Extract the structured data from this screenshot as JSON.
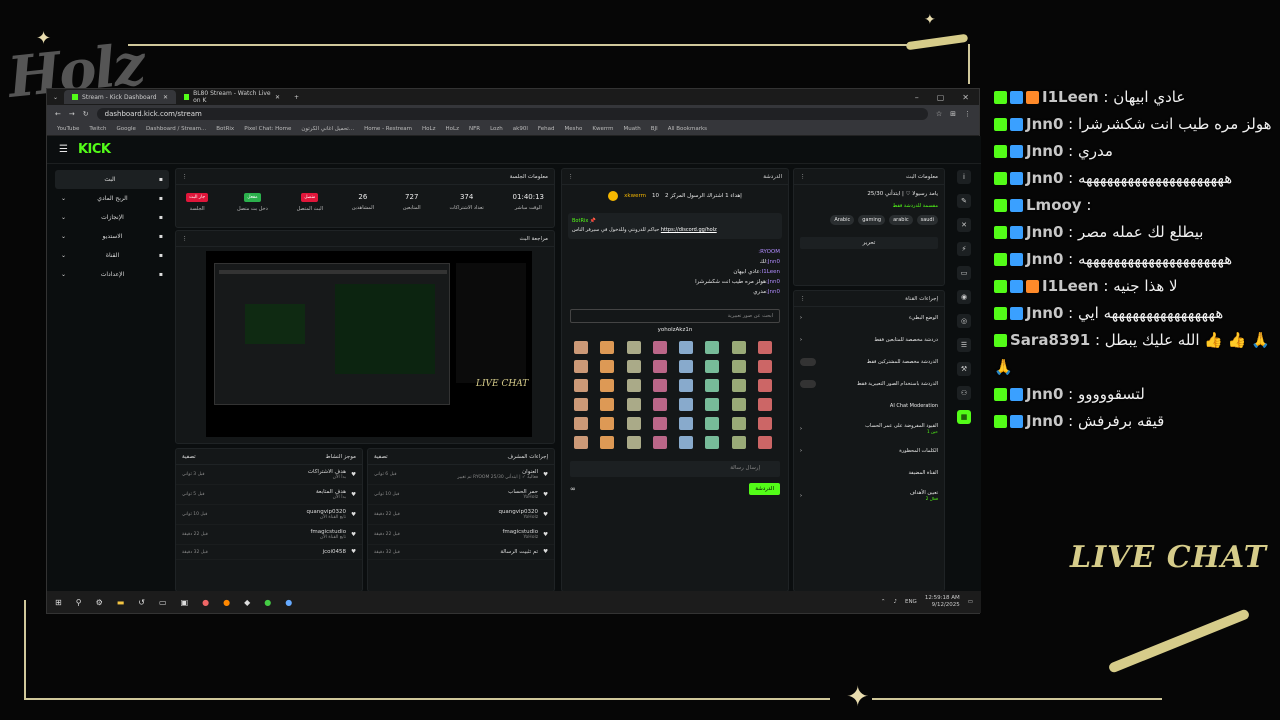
{
  "overlay": {
    "logo_text": "Holz",
    "live_chat_label": "LIVE CHAT"
  },
  "browser": {
    "tabs": [
      {
        "label": "Stream - Kick Dashboard",
        "active": true
      },
      {
        "label": "BL80 Stream - Watch Live on K",
        "active": false
      }
    ],
    "url": "dashboard.kick.com/stream",
    "bookmarks": [
      "YouTube",
      "Twitch",
      "Google",
      "Dashboard / Stream...",
      "BotRix",
      "Pixel Chat: Home",
      "تحميل اغاني الكرتون...",
      "Home - Restream",
      "HoLz",
      "HoLz",
      "NFR",
      "Lozh",
      "ak90l",
      "Fehad",
      "Mesho",
      "Kwerrm",
      "Muath",
      "BJl",
      "All Bookmarks"
    ]
  },
  "kick": {
    "logo": "KICK",
    "nav": [
      {
        "label": "البث",
        "icon": "live-icon"
      },
      {
        "label": "الربح المادي",
        "icon": "money-icon"
      },
      {
        "label": "الإنجازات",
        "icon": "trophy-icon"
      },
      {
        "label": "الاستديو",
        "icon": "studio-icon"
      },
      {
        "label": "القناة",
        "icon": "channel-icon"
      },
      {
        "label": "الإعدادات",
        "icon": "settings-icon"
      }
    ],
    "session": {
      "title": "معلومات الجلسة",
      "stats": [
        {
          "value": "01:40:13",
          "label": "الوقت مباشر"
        },
        {
          "value": "374",
          "label": "تعداد الاشتراكات"
        },
        {
          "value": "727",
          "label": "المتابعين"
        },
        {
          "value": "26",
          "label": "المشاهدين"
        }
      ],
      "badges": [
        {
          "text": "متصل",
          "label": "البث المتصل",
          "color": "#e0163a"
        },
        {
          "text": "مفعل",
          "label": "دخل بث متصل",
          "color": "#2bb14c"
        },
        {
          "text": "جار البث",
          "label": "الجلسة",
          "color": "#e0163a"
        }
      ]
    },
    "preview_title": "مراجعة البث",
    "preview_overlay": "LIVE CHAT",
    "activity": {
      "title": "موجز النشاط",
      "filter": "تصفية",
      "rows": [
        {
          "text": "هدف الاشتراكات",
          "sub": "بدأ الآن",
          "time": "قبل 3 ثواني"
        },
        {
          "text": "هدف المتابعة",
          "sub": "بدأ الآن",
          "time": "قبل 5 ثواني"
        },
        {
          "text": "quangvip0320",
          "sub": "تابع القناة الآن",
          "time": "قبل 10 ثواني"
        },
        {
          "text": "fmagicstudio",
          "sub": "تابع القناة الآن",
          "time": "قبل 22 دقيقة"
        },
        {
          "text": "jcoi0458",
          "sub": "",
          "time": "قبل 32 دقيقة"
        }
      ]
    },
    "mod": {
      "title": "إجراءات المشرف",
      "filter": "تصفية",
      "header_note": "حاليا، شاهد",
      "rows": [
        {
          "text": "العنوان",
          "sub": "تم تغيير RYOOM فعالية ✓ | ابتدأني 25/30",
          "time": "قبل 6 ثواني"
        },
        {
          "text": "حمر الحساب",
          "sub": "YoHolz",
          "time": "قبل 10 ثواني"
        },
        {
          "text": "quangvip0320",
          "sub": "YoHolz",
          "time": "قبل 22 دقيقة"
        },
        {
          "text": "fmagicstudio",
          "sub": "YoHolz",
          "time": "قبل 22 دقيقة"
        },
        {
          "text": "تم تثبيت الرسالة",
          "sub": "",
          "time": "قبل 32 دقيقة"
        }
      ]
    },
    "chat": {
      "title": "الدردشة",
      "top_user": "xkwerm",
      "top_count": "10",
      "top_text": "إهداء 1 اشتراك الرسول المركز 2",
      "pinned_by": "BotRix",
      "pinned_link": "https://discord.gg/holz",
      "pinned_text": "حياكم للدرونتي وللدخول في سيرفر الناس",
      "messages": [
        {
          "user": "RYOOM:",
          "text": ""
        },
        {
          "user": "Jnn0:",
          "text": "لك"
        },
        {
          "user": "I1Leen:",
          "text": "عادي ابيهان"
        },
        {
          "user": "Jnn0:",
          "text": "هولز مره طيب انت شكشرشرا"
        },
        {
          "user": "Jnn0:",
          "text": "مدري"
        }
      ],
      "search_placeholder": "ابحث عن صور تعبيرية",
      "emote_tooltip": "yoholzAkz1n",
      "input_placeholder": "إرسال رسالة",
      "send_label": "الدردشة"
    },
    "stream_info": {
      "title": "معلومات البث",
      "stream_title": "يامد رسيولا ♡ | ابتدأني 25/30",
      "category": "مقسمة للدردشة فقط",
      "tags": [
        "Arabic",
        "gaming",
        "arabic",
        "saudi"
      ],
      "edit_label": "تحرير"
    },
    "channel_actions": {
      "title": "إجراءات القناة",
      "rows": [
        {
          "label": "الوضع البطيء",
          "control": "arrow"
        },
        {
          "label": "دردشة مخصصة للمتابعين فقط",
          "control": "arrow"
        },
        {
          "label": "الدردشة مخصصة للمشتركين فقط",
          "control": "toggle"
        },
        {
          "label": "الدردشة باستخدام الصور التعبيرية فقط",
          "control": "toggle"
        },
        {
          "label": "AI Chat Moderation",
          "control": "none"
        },
        {
          "label": "القيود المفروضة على عمر الحساب",
          "control": "arrow",
          "value": "حين 1"
        },
        {
          "label": "الكلمات المحظورة",
          "control": "arrow"
        },
        {
          "label": "القناة المضيفة",
          "control": "none"
        },
        {
          "label": "تعيين الأهداف",
          "control": "arrow",
          "value": "فعال 2"
        }
      ]
    }
  },
  "taskbar": {
    "lang": "ENG",
    "time": "12:59:18 AM",
    "date": "9/12/2025"
  },
  "live_chat": [
    {
      "badges": [
        "k",
        "g",
        "o"
      ],
      "user": "I1Leen",
      "text": "عادي ابيهان"
    },
    {
      "badges": [
        "k",
        "g"
      ],
      "user": "Jnn0",
      "text": "هولز مره طيب انت شكشرشرا"
    },
    {
      "badges": [
        "k",
        "g"
      ],
      "user": "Jnn0",
      "text": "مدري"
    },
    {
      "badges": [
        "k",
        "g"
      ],
      "user": "Jnn0",
      "text": "هههههههههههههههههههههه"
    },
    {
      "badges": [
        "k",
        "g"
      ],
      "user": "Lmooy",
      "text": ""
    },
    {
      "badges": [
        "k",
        "g"
      ],
      "user": "Jnn0",
      "text": "بيطلع لك عمله مصر"
    },
    {
      "badges": [
        "k",
        "g"
      ],
      "user": "Jnn0",
      "text": "هههههههههههههههههههههه"
    },
    {
      "badges": [
        "k",
        "g",
        "o"
      ],
      "user": "I1Leen",
      "text": "لا هذا جنيه"
    },
    {
      "badges": [
        "k",
        "g"
      ],
      "user": "Jnn0",
      "text": "ههههههههههههههههه ايي"
    },
    {
      "badges": [
        "k"
      ],
      "user": "Sara8391",
      "text": "الله عليك يبطل 👍 👍 🙏 🙏"
    },
    {
      "badges": [
        "k",
        "g"
      ],
      "user": "Jnn0",
      "text": "لتسقووووو"
    },
    {
      "badges": [
        "k",
        "g"
      ],
      "user": "Jnn0",
      "text": "قيقه برفرفش"
    }
  ]
}
